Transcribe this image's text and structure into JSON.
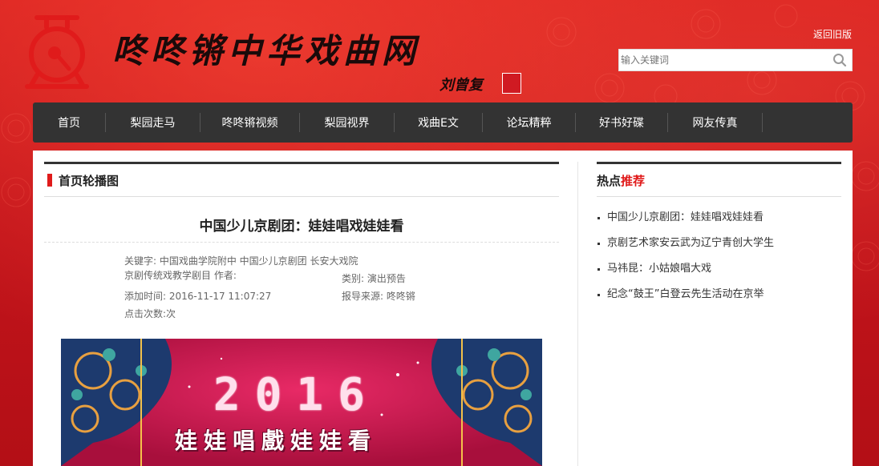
{
  "header": {
    "site_title": "咚咚锵中华戏曲网",
    "signature": "刘曾复",
    "old_version": "返回旧版",
    "search_placeholder": "输入关键词"
  },
  "nav": {
    "items": [
      "首页",
      "梨园走马",
      "咚咚锵视频",
      "梨园视界",
      "戏曲E文",
      "论坛精粹",
      "好书好碟",
      "网友传真"
    ]
  },
  "main": {
    "section_title": "首页轮播图",
    "article": {
      "title": "中国少儿京剧团：娃娃唱戏娃娃看",
      "keywords": "关键字: 中国戏曲学院附中 中国少儿京剧团 长安大戏院 京剧传统戏教学剧目",
      "author": "作者:",
      "category": "类别: 演出预告",
      "added_time": "添加时间: 2016-11-17 11:07:27",
      "source": "报导来源: 咚咚锵",
      "clicks": "点击次数:次"
    },
    "poster": {
      "year": "2016",
      "subtitle": "娃娃唱戲娃娃看"
    }
  },
  "sidebar": {
    "hot_title_prefix": "热点",
    "hot_title_suffix": "推荐",
    "items": [
      "中国少儿京剧团：娃娃唱戏娃娃看",
      "京剧艺术家安云武为辽宁青创大学生",
      "马祎昆：小姑娘唱大戏",
      "纪念“鼓王”白登云先生活动在京举"
    ]
  },
  "colors": {
    "brand_red": "#c8151c",
    "accent_red": "#e01b1b",
    "nav_bg": "#333333"
  }
}
